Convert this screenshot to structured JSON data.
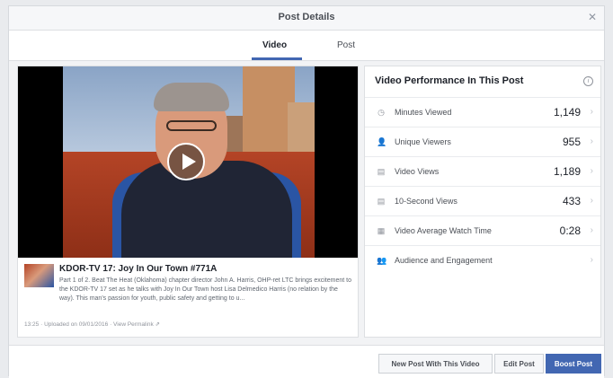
{
  "header": {
    "title": "Post Details",
    "close_icon": "close-icon"
  },
  "tabs": [
    {
      "label": "Video",
      "active": true
    },
    {
      "label": "Post",
      "active": false
    }
  ],
  "video": {
    "title": "KDOR-TV 17: Joy In Our Town #771A",
    "description": "Part 1 of 2. Beat The Heat (Oklahoma) chapter director John A. Harris, OHP-ret LTC brings excitement to the KDOR-TV 17 set as he talks with Joy In Our Town host Lisa Delmedico Harris (no relation by the way). This man's passion for youth, public safety and getting to u...",
    "duration": "13:25",
    "uploaded": "Uploaded on 09/01/2016",
    "permalink": "View Permalink"
  },
  "stats": {
    "title": "Video Performance In This Post",
    "rows": [
      {
        "icon": "clock-icon",
        "glyph": "◷",
        "label": "Minutes Viewed",
        "value": "1,149"
      },
      {
        "icon": "person-icon",
        "glyph": "👤",
        "label": "Unique Viewers",
        "value": "955"
      },
      {
        "icon": "video-views-icon",
        "glyph": "▤",
        "label": "Video Views",
        "value": "1,189"
      },
      {
        "icon": "ten-second-views-icon",
        "glyph": "▤",
        "label": "10-Second Views",
        "value": "433"
      },
      {
        "icon": "film-icon",
        "glyph": "▦",
        "label": "Video Average Watch Time",
        "value": "0:28"
      },
      {
        "icon": "audience-icon",
        "glyph": "👥",
        "label": "Audience and Engagement",
        "value": ""
      }
    ]
  },
  "footer": {
    "new_post_label": "New Post With This Video",
    "edit_label": "Edit Post",
    "boost_label": "Boost Post"
  },
  "colors": {
    "accent": "#4267b2",
    "border": "#dddfe2",
    "background": "#e9ebee"
  }
}
